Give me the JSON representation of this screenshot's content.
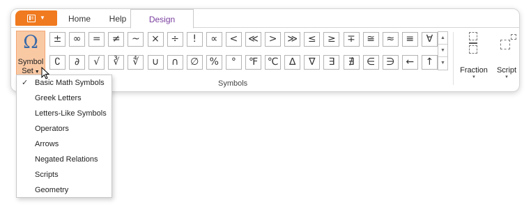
{
  "tabs": [
    {
      "label": "Home"
    },
    {
      "label": "Help"
    },
    {
      "label": "Design",
      "active": true
    }
  ],
  "symbol_set": {
    "omega": "Ω",
    "label_line1": "Symbol",
    "label_line2": "Set"
  },
  "symbols_row1": [
    "±",
    "∞",
    "=",
    "≠",
    "~",
    "×",
    "÷",
    "!",
    "∝",
    "<",
    "≪",
    ">",
    "≫",
    "≤",
    "≥",
    "∓",
    "≅",
    "≈",
    "≡",
    "∀"
  ],
  "symbols_row2": [
    "∁",
    "∂",
    "√",
    "∛",
    "∜",
    "∪",
    "∩",
    "∅",
    "%",
    "°",
    "℉",
    "℃",
    "∆",
    "∇",
    "∃",
    "∄",
    "∈",
    "∋",
    "←",
    "↑"
  ],
  "group_label": "Symbols",
  "fraction": {
    "label": "Fraction"
  },
  "script": {
    "label": "Script"
  },
  "dropdown": {
    "items": [
      {
        "label": "Basic Math Symbols",
        "checked": true
      },
      {
        "label": "Greek Letters"
      },
      {
        "label": "Letters-Like Symbols"
      },
      {
        "label": "Operators"
      },
      {
        "label": "Arrows"
      },
      {
        "label": "Negated Relations"
      },
      {
        "label": "Scripts"
      },
      {
        "label": "Geometry"
      }
    ],
    "check_mark": "✓"
  },
  "colors": {
    "accent": "#f07a1f",
    "active_tab_text": "#7a3ea0",
    "symbol_set_bg": "#f9c9a4",
    "omega": "#3a6aa8"
  }
}
